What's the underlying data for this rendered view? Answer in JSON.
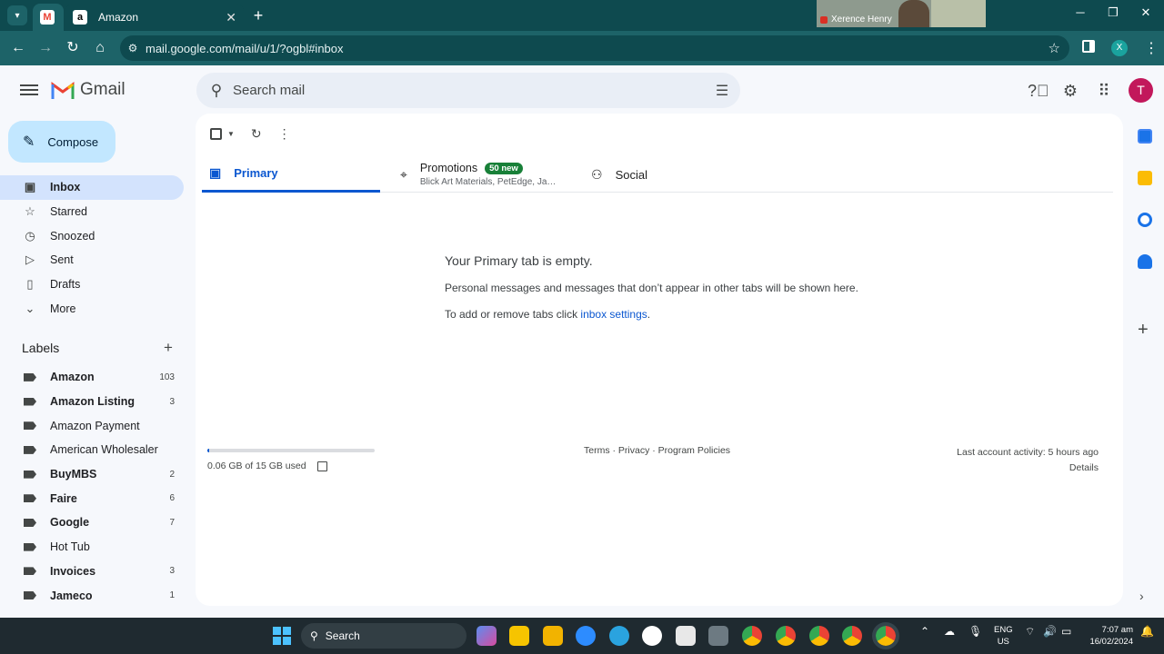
{
  "browser": {
    "tabs": [
      {
        "label": "",
        "favicon": "gmail-icon",
        "active": true
      },
      {
        "label": "Amazon",
        "favicon": "amazon-icon",
        "active": false
      }
    ],
    "video_call_name": "Xerence Henry",
    "url": "mail.google.com/mail/u/1/?ogbl#inbox",
    "profile_initial": "X"
  },
  "gmail": {
    "logo_text": "Gmail",
    "search_placeholder": "Search mail",
    "avatar_initial": "T",
    "compose_label": "Compose",
    "nav": [
      {
        "label": "Inbox",
        "icon": "inbox-icon",
        "active": true
      },
      {
        "label": "Starred",
        "icon": "star-icon"
      },
      {
        "label": "Snoozed",
        "icon": "clock-icon"
      },
      {
        "label": "Sent",
        "icon": "send-icon"
      },
      {
        "label": "Drafts",
        "icon": "draft-icon"
      },
      {
        "label": "More",
        "icon": "chevron-down-icon"
      }
    ],
    "labels_heading": "Labels",
    "labels": [
      {
        "label": "Amazon",
        "count": "103",
        "bold": true
      },
      {
        "label": "Amazon Listing",
        "count": "3",
        "bold": true
      },
      {
        "label": "Amazon Payment",
        "count": "",
        "bold": false
      },
      {
        "label": "American Wholesaler",
        "count": "",
        "bold": false
      },
      {
        "label": "BuyMBS",
        "count": "2",
        "bold": true
      },
      {
        "label": "Faire",
        "count": "6",
        "bold": true
      },
      {
        "label": "Google",
        "count": "7",
        "bold": true
      },
      {
        "label": "Hot Tub",
        "count": "",
        "bold": false
      },
      {
        "label": "Invoices",
        "count": "3",
        "bold": true
      },
      {
        "label": "Jameco",
        "count": "1",
        "bold": true
      }
    ],
    "tabs": {
      "primary": "Primary",
      "promotions": "Promotions",
      "promotions_badge": "50 new",
      "promotions_senders": "Blick Art Materials, PetEdge, Ja…",
      "social": "Social"
    },
    "empty": {
      "title": "Your Primary tab is empty.",
      "description": "Personal messages and messages that don’t appear in other tabs will be shown here.",
      "hint_prefix": "To add or remove tabs click ",
      "hint_link": "inbox settings",
      "hint_suffix": "."
    },
    "storage": {
      "text": "0.06 GB of 15 GB used",
      "fraction": 0.004
    },
    "footer_links": "Terms · Privacy · Program Policies",
    "activity": {
      "last": "Last account activity: 5 hours ago",
      "details": "Details"
    }
  },
  "taskbar": {
    "search_label": "Search",
    "language": "ENG",
    "region": "US",
    "time": "7:07 am",
    "date": "16/02/2024"
  },
  "colors": {
    "chrome_dark": "#0e4a4f",
    "chrome_light": "#1d6368",
    "gmail_bg": "#f6f8fc",
    "active_blue": "#0b57d0",
    "compose_bg": "#c2e7ff",
    "badge_green": "#188038"
  }
}
